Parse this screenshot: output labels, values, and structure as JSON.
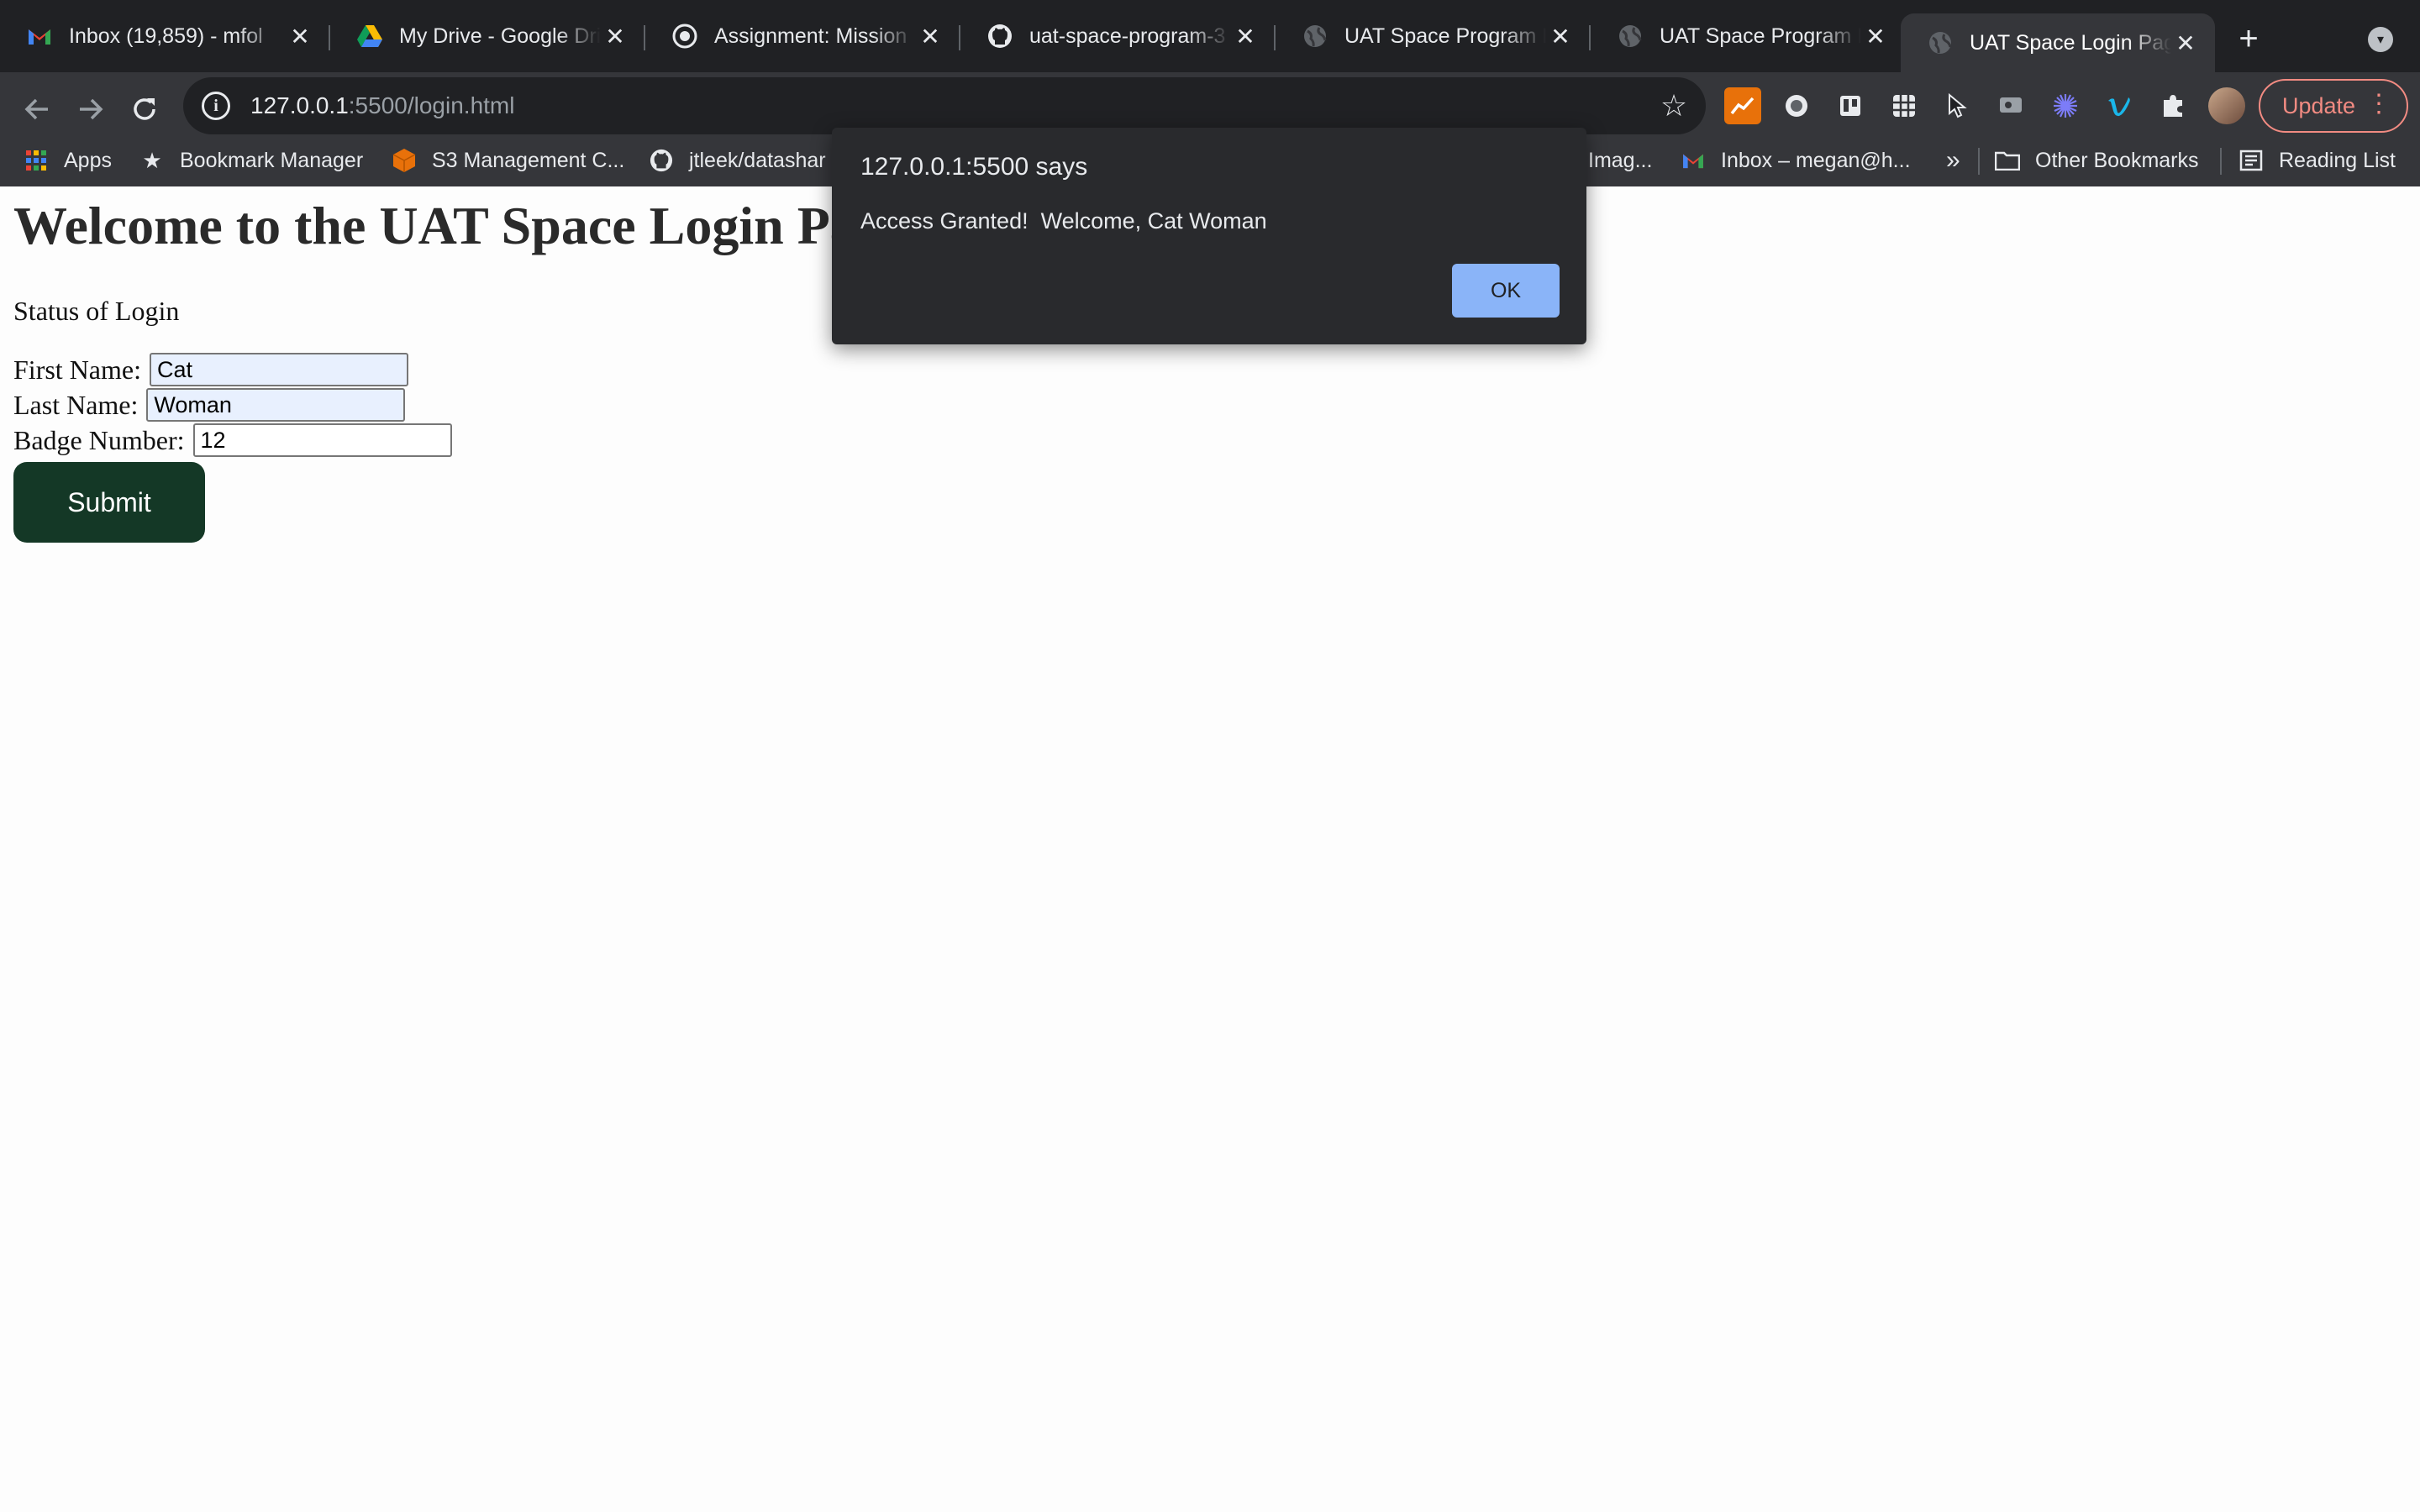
{
  "browser": {
    "tabs": [
      {
        "title": "Inbox (19,859) - mfol",
        "icon": "gmail-icon"
      },
      {
        "title": "My Drive - Google Dri",
        "icon": "google-drive-icon"
      },
      {
        "title": "Assignment: Mission",
        "icon": "uat-icon"
      },
      {
        "title": "uat-space-program-3",
        "icon": "github-icon"
      },
      {
        "title": "UAT Space Program D",
        "icon": "globe-icon"
      },
      {
        "title": "UAT Space Program D",
        "icon": "globe-icon"
      },
      {
        "title": "UAT Space Login Pag",
        "icon": "globe-icon",
        "active": true
      }
    ],
    "address": {
      "host": "127.0.0.1",
      "path": ":5500/login.html"
    },
    "update_label": "Update",
    "bookmarks": [
      {
        "label": "Apps",
        "icon": "apps-grid-icon"
      },
      {
        "label": "Bookmark Manager",
        "icon": "star-icon"
      },
      {
        "label": "S3 Management C...",
        "icon": "aws-s3-icon"
      },
      {
        "label": "jtleek/datashar",
        "icon": "github-icon"
      },
      {
        "label": "Imag...",
        "icon": ""
      },
      {
        "label": "Inbox – megan@h...",
        "icon": "gmail-icon"
      },
      {
        "label": "»",
        "icon": ""
      },
      {
        "label": "Other Bookmarks",
        "icon": "folder-icon"
      },
      {
        "label": "Reading List",
        "icon": "reading-list-icon"
      }
    ]
  },
  "page": {
    "heading": "Welcome to the UAT Space Login Page",
    "status": "Status of Login",
    "form": {
      "first_name_label": "First Name:",
      "first_name_value": "Cat",
      "last_name_label": "Last Name:",
      "last_name_value": "Woman",
      "badge_label": "Badge Number:",
      "badge_value": "12",
      "submit_label": "Submit"
    }
  },
  "dialog": {
    "title": "127.0.0.1:5500 says",
    "message": "Access Granted!  Welcome, Cat Woman",
    "ok_label": "OK"
  },
  "colors": {
    "submit_bg": "#143826",
    "dialog_ok": "#8ab4f8",
    "autofill_bg": "#e8f0fe"
  }
}
